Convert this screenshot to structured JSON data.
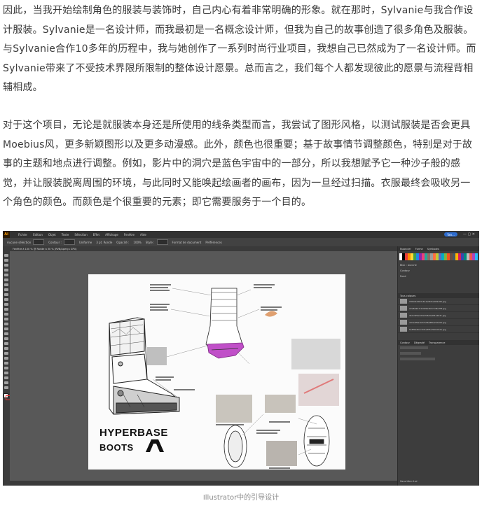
{
  "article": {
    "paragraph1": "因此，当我开始绘制角色的服装与装饰时，自己内心有着非常明确的形象。就在那时，Sylvanie与我合作设计服装。Sylvanie是一名设计师，而我最初是一名概念设计师，但我为自己的故事创造了很多角色及服装。与Sylvanie合作10多年的历程中，我与她创作了一系列时尚行业项目，我想自己已然成为了一名设计师。而Sylvanie带来了不受技术界限所限制的整体设计愿景。总而言之，我们每个人都发现彼此的愿景与流程背相辅相成。",
    "paragraph2": "对于这个项目，无论是就服装本身还是所使用的线条类型而言，我尝试了图形风格，以测试服装是否会更具Moebius风，更多新颖图形以及更多动漫感。此外，颜色也很重要；基于故事情节调整颜色，特别是对于故事的主题和地点进行调整。例如，影片中的洞穴是蓝色宇宙中的一部分，所以我想赋予它一种沙子般的感觉，并让服装脱离周围的环境，与此同时又能唤起绘画者的画布，因为一旦经过扫描。衣服最终会吸收另一个角色的颜色。而颜色是个很重要的元素；即它需要服务于一个目的。",
    "caption": "Illustrator中的引导设计"
  },
  "screenshot": {
    "app_logo": "Ai",
    "menus": [
      "Fichier",
      "Edition",
      "Objet",
      "Texte",
      "Sélection",
      "Effet",
      "Affichage",
      "Fenêtre",
      "Aide"
    ],
    "account": "Yan...",
    "control_bar": [
      "Aucune sélection",
      "Contour :",
      "Uniforme",
      "3 pt. Ronde",
      "Opacité :",
      "100%",
      "Style :",
      "Format de document",
      "Préférences"
    ],
    "doc_tab": "Fenêtre à 100 % @ Ronde à 30 % (RVB/Aperçu GPU)",
    "panel_tabs": [
      "Nuancier",
      "Forme",
      "Symboles"
    ],
    "panel_rows": [
      "Bloc : aucune",
      "Contour",
      "Fond",
      "Tous calques",
      "Sans titre-1.ai"
    ],
    "layer_files": [
      "1f06c9d2b3c4a1e9fd1a4b9c8d.jpg",
      "22a8e9b7c0d1f2a3b4c5d6e7f8.jpg",
      "3b1c9f5e4d2a7b8c6e0f1a2b3c.jpg",
      "4d7e2f9a1b3c5d6e8f0a2b4c6d.jpg",
      "5e8f0a2b4c6d1e3f5a7b9c0d2e.jpg"
    ],
    "props_tabs": [
      "Contour",
      "Dégradé",
      "Transparence"
    ],
    "artboard_title_line1": "HYPERBASE",
    "artboard_title_line2": "BOOTS"
  },
  "colors": {
    "text": "#3b3b3b",
    "caption": "#8a8a8a",
    "app_bg": "#535353",
    "accent_magenta": "#c04fc8",
    "ai_orange": "#ff9a00"
  }
}
